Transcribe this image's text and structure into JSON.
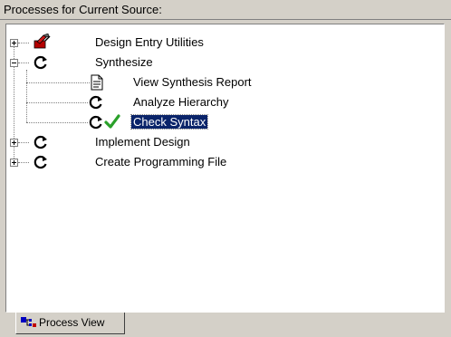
{
  "panel": {
    "title": "Processes for Current Source:"
  },
  "tree": {
    "items": [
      {
        "label": "Design Entry Utilities",
        "icon": "tools-icon",
        "expanded": false
      },
      {
        "label": "Synthesize",
        "icon": "process-cycle-icon",
        "expanded": true,
        "children": [
          {
            "label": "View Synthesis Report",
            "icon": "document-icon"
          },
          {
            "label": "Analyze Hierarchy",
            "icon": "process-cycle-icon"
          },
          {
            "label": "Check Syntax",
            "icon": "process-cycle-check-icon",
            "selected": true,
            "status": "passed"
          }
        ]
      },
      {
        "label": "Implement Design",
        "icon": "process-cycle-icon",
        "expanded": false
      },
      {
        "label": "Create Programming File",
        "icon": "process-cycle-icon",
        "expanded": false
      }
    ]
  },
  "tabs": [
    {
      "label": "Process View",
      "icon": "process-view-icon",
      "active": true
    }
  ],
  "colors": {
    "selection": "#0a246a",
    "check": "#2aa02a",
    "panel": "#d4d0c8"
  }
}
